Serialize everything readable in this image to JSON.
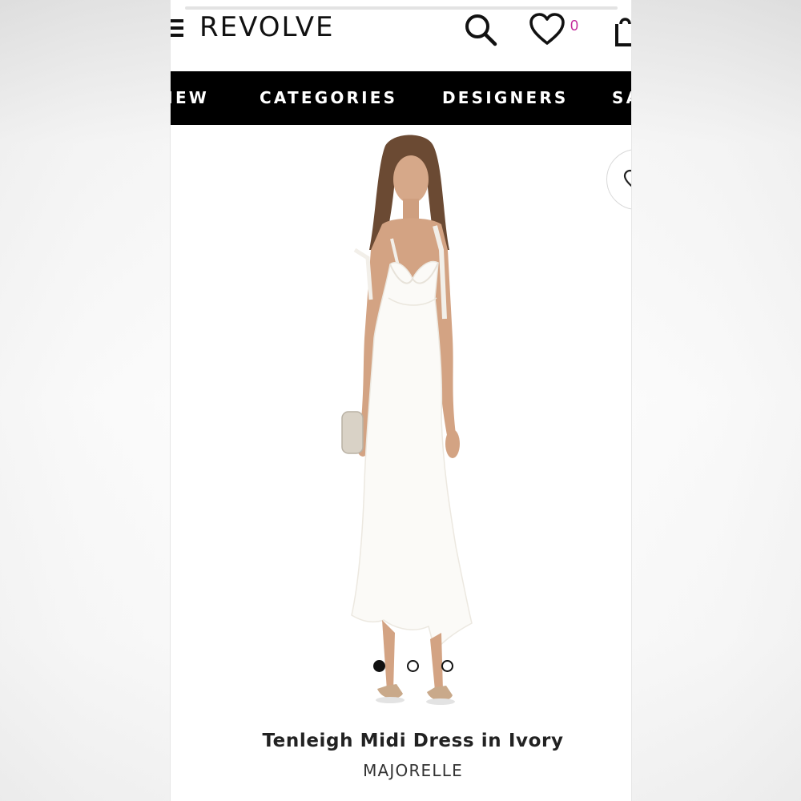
{
  "header": {
    "logo": "REVOLVE",
    "wishlist_count": "0"
  },
  "nav": {
    "items": [
      "NEW",
      "CATEGORIES",
      "DESIGNERS",
      "SALE"
    ]
  },
  "gallery": {
    "image_count": 3,
    "active_index": 0
  },
  "product": {
    "name": "Tenleigh Midi Dress in Ivory",
    "brand": "MAJORELLE"
  },
  "colors": {
    "navbar_bg": "#000000",
    "navbar_text": "#ffffff",
    "wishlist_count": "#c3299b",
    "dress": "#fbfaf7"
  }
}
